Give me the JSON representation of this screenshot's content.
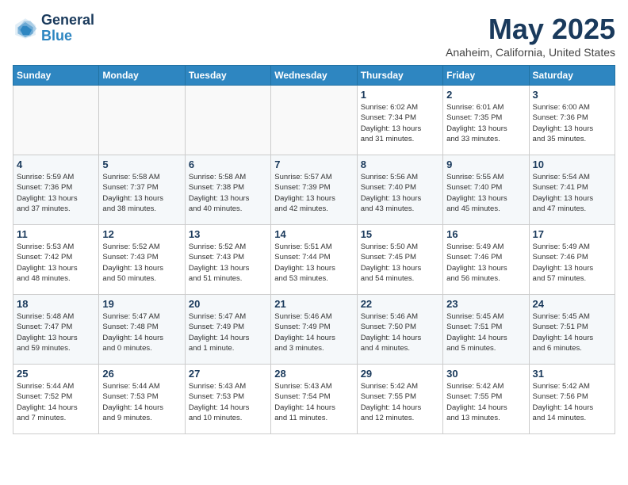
{
  "header": {
    "logo_line1": "General",
    "logo_line2": "Blue",
    "month": "May 2025",
    "location": "Anaheim, California, United States"
  },
  "weekdays": [
    "Sunday",
    "Monday",
    "Tuesday",
    "Wednesday",
    "Thursday",
    "Friday",
    "Saturday"
  ],
  "weeks": [
    [
      {
        "day": "",
        "info": ""
      },
      {
        "day": "",
        "info": ""
      },
      {
        "day": "",
        "info": ""
      },
      {
        "day": "",
        "info": ""
      },
      {
        "day": "1",
        "info": "Sunrise: 6:02 AM\nSunset: 7:34 PM\nDaylight: 13 hours\nand 31 minutes."
      },
      {
        "day": "2",
        "info": "Sunrise: 6:01 AM\nSunset: 7:35 PM\nDaylight: 13 hours\nand 33 minutes."
      },
      {
        "day": "3",
        "info": "Sunrise: 6:00 AM\nSunset: 7:36 PM\nDaylight: 13 hours\nand 35 minutes."
      }
    ],
    [
      {
        "day": "4",
        "info": "Sunrise: 5:59 AM\nSunset: 7:36 PM\nDaylight: 13 hours\nand 37 minutes."
      },
      {
        "day": "5",
        "info": "Sunrise: 5:58 AM\nSunset: 7:37 PM\nDaylight: 13 hours\nand 38 minutes."
      },
      {
        "day": "6",
        "info": "Sunrise: 5:58 AM\nSunset: 7:38 PM\nDaylight: 13 hours\nand 40 minutes."
      },
      {
        "day": "7",
        "info": "Sunrise: 5:57 AM\nSunset: 7:39 PM\nDaylight: 13 hours\nand 42 minutes."
      },
      {
        "day": "8",
        "info": "Sunrise: 5:56 AM\nSunset: 7:40 PM\nDaylight: 13 hours\nand 43 minutes."
      },
      {
        "day": "9",
        "info": "Sunrise: 5:55 AM\nSunset: 7:40 PM\nDaylight: 13 hours\nand 45 minutes."
      },
      {
        "day": "10",
        "info": "Sunrise: 5:54 AM\nSunset: 7:41 PM\nDaylight: 13 hours\nand 47 minutes."
      }
    ],
    [
      {
        "day": "11",
        "info": "Sunrise: 5:53 AM\nSunset: 7:42 PM\nDaylight: 13 hours\nand 48 minutes."
      },
      {
        "day": "12",
        "info": "Sunrise: 5:52 AM\nSunset: 7:43 PM\nDaylight: 13 hours\nand 50 minutes."
      },
      {
        "day": "13",
        "info": "Sunrise: 5:52 AM\nSunset: 7:43 PM\nDaylight: 13 hours\nand 51 minutes."
      },
      {
        "day": "14",
        "info": "Sunrise: 5:51 AM\nSunset: 7:44 PM\nDaylight: 13 hours\nand 53 minutes."
      },
      {
        "day": "15",
        "info": "Sunrise: 5:50 AM\nSunset: 7:45 PM\nDaylight: 13 hours\nand 54 minutes."
      },
      {
        "day": "16",
        "info": "Sunrise: 5:49 AM\nSunset: 7:46 PM\nDaylight: 13 hours\nand 56 minutes."
      },
      {
        "day": "17",
        "info": "Sunrise: 5:49 AM\nSunset: 7:46 PM\nDaylight: 13 hours\nand 57 minutes."
      }
    ],
    [
      {
        "day": "18",
        "info": "Sunrise: 5:48 AM\nSunset: 7:47 PM\nDaylight: 13 hours\nand 59 minutes."
      },
      {
        "day": "19",
        "info": "Sunrise: 5:47 AM\nSunset: 7:48 PM\nDaylight: 14 hours\nand 0 minutes."
      },
      {
        "day": "20",
        "info": "Sunrise: 5:47 AM\nSunset: 7:49 PM\nDaylight: 14 hours\nand 1 minute."
      },
      {
        "day": "21",
        "info": "Sunrise: 5:46 AM\nSunset: 7:49 PM\nDaylight: 14 hours\nand 3 minutes."
      },
      {
        "day": "22",
        "info": "Sunrise: 5:46 AM\nSunset: 7:50 PM\nDaylight: 14 hours\nand 4 minutes."
      },
      {
        "day": "23",
        "info": "Sunrise: 5:45 AM\nSunset: 7:51 PM\nDaylight: 14 hours\nand 5 minutes."
      },
      {
        "day": "24",
        "info": "Sunrise: 5:45 AM\nSunset: 7:51 PM\nDaylight: 14 hours\nand 6 minutes."
      }
    ],
    [
      {
        "day": "25",
        "info": "Sunrise: 5:44 AM\nSunset: 7:52 PM\nDaylight: 14 hours\nand 7 minutes."
      },
      {
        "day": "26",
        "info": "Sunrise: 5:44 AM\nSunset: 7:53 PM\nDaylight: 14 hours\nand 9 minutes."
      },
      {
        "day": "27",
        "info": "Sunrise: 5:43 AM\nSunset: 7:53 PM\nDaylight: 14 hours\nand 10 minutes."
      },
      {
        "day": "28",
        "info": "Sunrise: 5:43 AM\nSunset: 7:54 PM\nDaylight: 14 hours\nand 11 minutes."
      },
      {
        "day": "29",
        "info": "Sunrise: 5:42 AM\nSunset: 7:55 PM\nDaylight: 14 hours\nand 12 minutes."
      },
      {
        "day": "30",
        "info": "Sunrise: 5:42 AM\nSunset: 7:55 PM\nDaylight: 14 hours\nand 13 minutes."
      },
      {
        "day": "31",
        "info": "Sunrise: 5:42 AM\nSunset: 7:56 PM\nDaylight: 14 hours\nand 14 minutes."
      }
    ]
  ]
}
